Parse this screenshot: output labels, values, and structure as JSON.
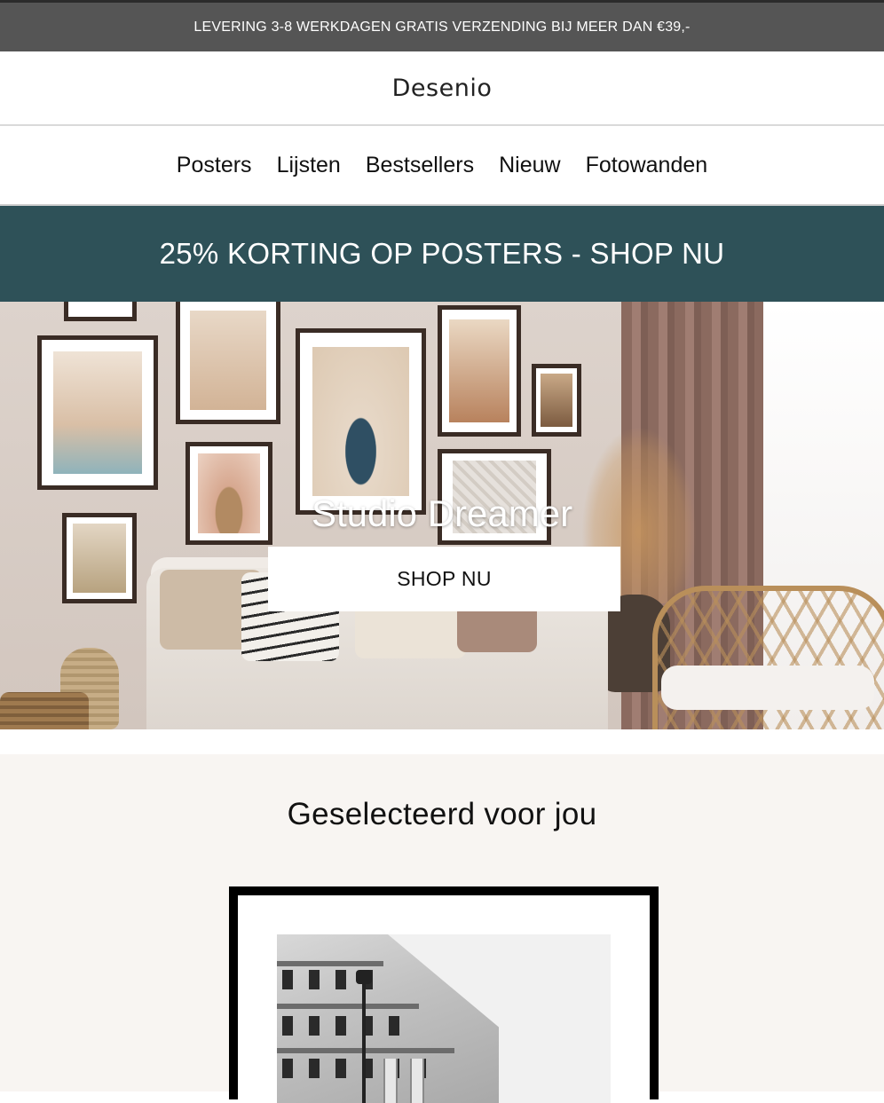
{
  "promo_bar": {
    "text": "LEVERING 3-8 WERKDAGEN GRATIS VERZENDING BIJ MEER DAN €39,-"
  },
  "header": {
    "logo": "Desenio"
  },
  "nav": {
    "items": [
      "Posters",
      "Lijsten",
      "Bestsellers",
      "Nieuw",
      "Fotowanden"
    ]
  },
  "sale_banner": {
    "text": "25% KORTING OP POSTERS - SHOP NU",
    "background": "#2e5158"
  },
  "hero": {
    "title": "Studio Dreamer",
    "button_label": "SHOP NU"
  },
  "selected": {
    "title": "Geselecteerd voor jou"
  },
  "colors": {
    "promo_bg": "#555555",
    "banner_bg": "#2e5158",
    "section_bg": "#f8f5f2"
  }
}
